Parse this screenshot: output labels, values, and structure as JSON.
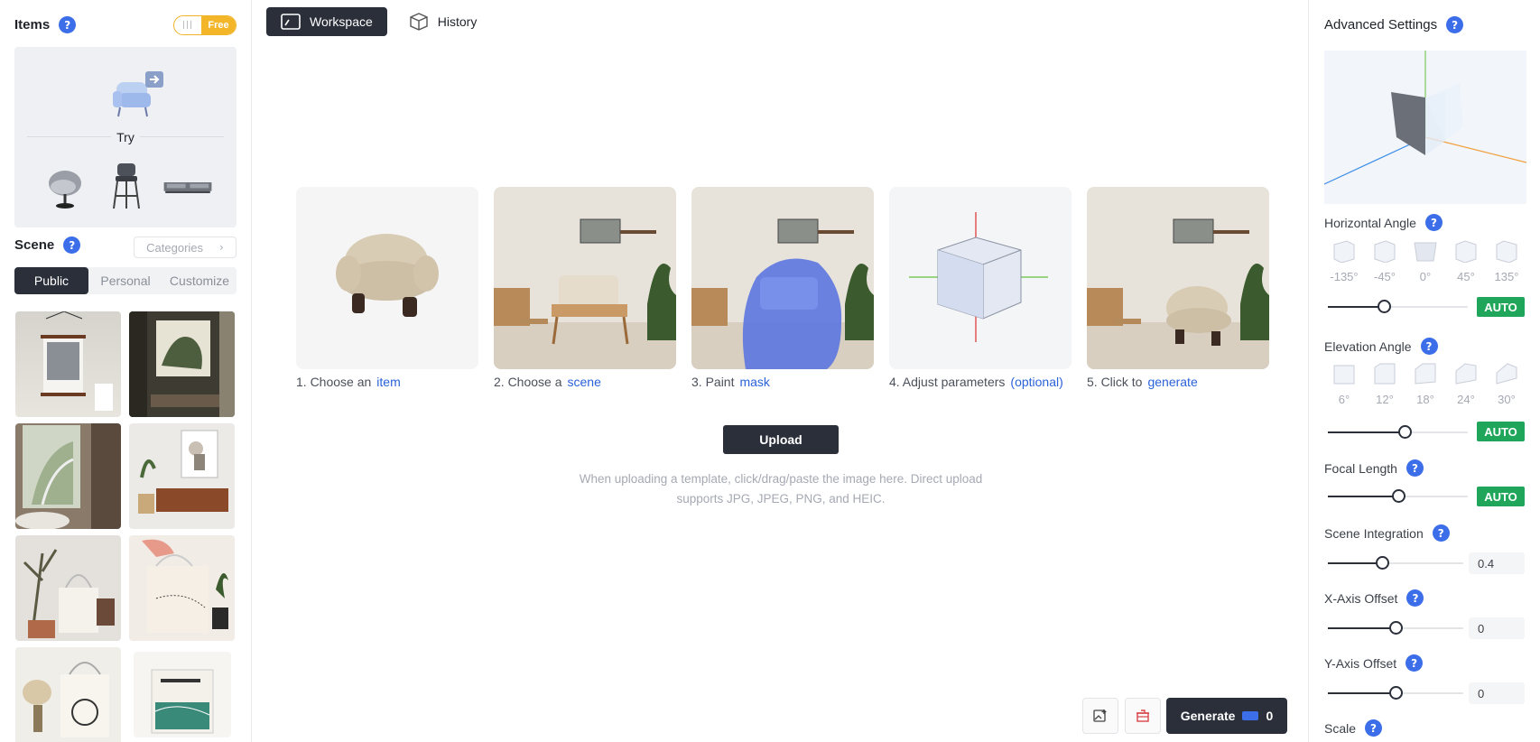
{
  "left": {
    "items_title": "Items",
    "free_toggle": "Free",
    "try_label": "Try",
    "scene_title": "Scene",
    "categories_label": "Categories",
    "scene_tabs": [
      "Public",
      "Personal",
      "Customize"
    ]
  },
  "main": {
    "tabs": [
      "Workspace",
      "History"
    ],
    "steps": [
      {
        "prefix": "1. Choose an",
        "link": "item"
      },
      {
        "prefix": "2. Choose a",
        "link": "scene"
      },
      {
        "prefix": "3. Paint",
        "link": "mask"
      },
      {
        "prefix": "4. Adjust parameters",
        "link": "(optional)"
      },
      {
        "prefix": "5. Click to",
        "link": "generate"
      }
    ],
    "upload_label": "Upload",
    "upload_hint_1": "When uploading a template, click/drag/paste the image here. Direct upload",
    "upload_hint_2": "supports JPG, JPEG, PNG, and HEIC.",
    "generate_label": "Generate",
    "generate_cost": "0"
  },
  "right": {
    "title": "Advanced Settings",
    "horizontal_angle": {
      "label": "Horizontal Angle",
      "options": [
        "-135°",
        "-45°",
        "0°",
        "45°",
        "135°"
      ],
      "auto": "AUTO",
      "slider": 0.4
    },
    "elevation_angle": {
      "label": "Elevation Angle",
      "options": [
        "6°",
        "12°",
        "18°",
        "24°",
        "30°"
      ],
      "auto": "AUTO",
      "slider": 0.55
    },
    "focal_length": {
      "label": "Focal Length",
      "auto": "AUTO",
      "slider": 0.5
    },
    "scene_integration": {
      "label": "Scene Integration",
      "value": "0.4",
      "slider": 0.4
    },
    "x_axis_offset": {
      "label": "X-Axis Offset",
      "value": "0",
      "slider": 0.5
    },
    "y_axis_offset": {
      "label": "Y-Axis Offset",
      "value": "0",
      "slider": 0.5
    },
    "scale": {
      "label": "Scale"
    }
  },
  "colors": {
    "accent": "#2a62d8",
    "dark": "#2a2f3a",
    "auto_green": "#20a65a",
    "free_yellow": "#f2b628"
  },
  "icons": [
    "help-icon",
    "chair-try-icon",
    "workspace-icon",
    "history-cube-icon",
    "chevron-right-icon",
    "image-add-icon",
    "trash-icon",
    "coin-icon"
  ]
}
